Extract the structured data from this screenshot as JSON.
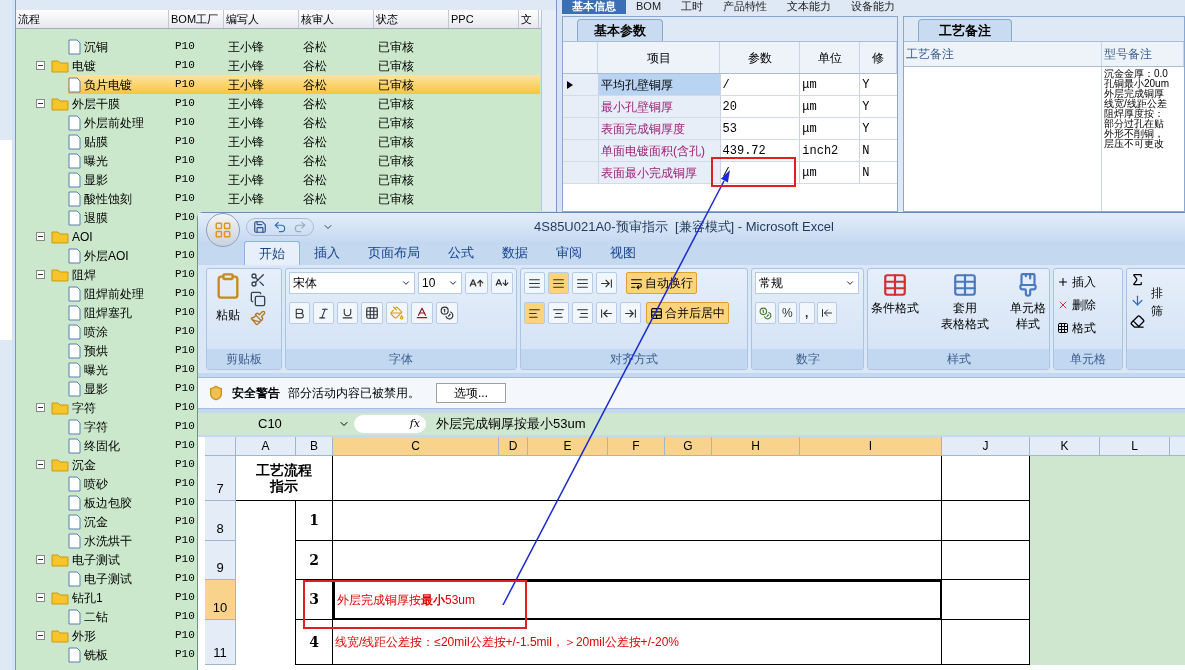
{
  "app_tabs": [
    {
      "label": "基本信息",
      "selected": true
    },
    {
      "label": "BOM",
      "selected": false
    },
    {
      "label": "工时",
      "selected": false
    },
    {
      "label": "产品特性",
      "selected": false
    },
    {
      "label": "文本能力",
      "selected": false
    },
    {
      "label": "设备能力",
      "selected": false
    }
  ],
  "tree": {
    "columns": [
      "流程",
      "BOM工厂",
      "编写人",
      "核审人",
      "状态",
      "PPC",
      "文"
    ],
    "groups": [
      {
        "children": [
          {
            "label": "沉铜",
            "factory": "P10",
            "author": "王小锋",
            "reviewer": "谷松",
            "status": "已审核",
            "selected": false
          }
        ]
      },
      {
        "label": "电镀",
        "factory": "P10",
        "author": "王小锋",
        "reviewer": "谷松",
        "status": "已审核",
        "selected": false,
        "expanded": true,
        "children": [
          {
            "label": "负片电镀",
            "factory": "P10",
            "author": "王小锋",
            "reviewer": "谷松",
            "status": "已审核",
            "selected": true
          }
        ]
      },
      {
        "label": "外层干膜",
        "factory": "P10",
        "author": "王小锋",
        "reviewer": "谷松",
        "status": "已审核",
        "selected": false,
        "expanded": true,
        "children": [
          {
            "label": "外层前处理",
            "factory": "P10",
            "author": "王小锋",
            "reviewer": "谷松",
            "status": "已审核",
            "selected": false
          },
          {
            "label": "贴膜",
            "factory": "P10",
            "author": "王小锋",
            "reviewer": "谷松",
            "status": "已审核",
            "selected": false
          },
          {
            "label": "曝光",
            "factory": "P10",
            "author": "王小锋",
            "reviewer": "谷松",
            "status": "已审核",
            "selected": false
          },
          {
            "label": "显影",
            "factory": "P10",
            "author": "王小锋",
            "reviewer": "谷松",
            "status": "已审核",
            "selected": false
          },
          {
            "label": "酸性蚀刻",
            "factory": "P10",
            "author": "王小锋",
            "reviewer": "谷松",
            "status": "已审核",
            "selected": false
          },
          {
            "label": "退膜",
            "factory": "P10",
            "selected": false
          }
        ]
      },
      {
        "label": "AOI",
        "factory": "P10",
        "selected": false,
        "expanded": true,
        "children": [
          {
            "label": "外层AOI",
            "factory": "P10",
            "selected": false
          }
        ]
      },
      {
        "label": "阻焊",
        "factory": "P10",
        "selected": false,
        "expanded": true,
        "children": [
          {
            "label": "阻焊前处理",
            "factory": "P10",
            "selected": false
          },
          {
            "label": "阻焊塞孔",
            "factory": "P10",
            "selected": false
          },
          {
            "label": "喷涂",
            "factory": "P10",
            "selected": false
          },
          {
            "label": "预烘",
            "factory": "P10",
            "selected": false
          },
          {
            "label": "曝光",
            "factory": "P10",
            "selected": false
          },
          {
            "label": "显影",
            "factory": "P10",
            "selected": false
          }
        ]
      },
      {
        "label": "字符",
        "factory": "P10",
        "selected": false,
        "expanded": true,
        "children": [
          {
            "label": "字符",
            "factory": "P10",
            "selected": false
          },
          {
            "label": "终固化",
            "factory": "P10",
            "selected": false
          }
        ]
      },
      {
        "label": "沉金",
        "factory": "P10",
        "selected": false,
        "expanded": true,
        "children": [
          {
            "label": "喷砂",
            "factory": "P10",
            "selected": false
          },
          {
            "label": "板边包胶",
            "factory": "P10",
            "selected": false
          },
          {
            "label": "沉金",
            "factory": "P10",
            "selected": false
          },
          {
            "label": "水洗烘干",
            "factory": "P10",
            "selected": false
          }
        ]
      },
      {
        "label": "电子测试",
        "factory": "P10",
        "selected": false,
        "expanded": true,
        "children": [
          {
            "label": "电子测试",
            "factory": "P10",
            "selected": false
          }
        ]
      },
      {
        "label": "钻孔1",
        "factory": "P10",
        "selected": false,
        "expanded": true,
        "children": [
          {
            "label": "二钻",
            "factory": "P10",
            "selected": false
          }
        ]
      },
      {
        "label": "外形",
        "factory": "P10",
        "selected": false,
        "expanded": true,
        "children": [
          {
            "label": "铣板",
            "factory": "P10",
            "selected": false
          }
        ]
      }
    ]
  },
  "params": {
    "tab": "基本参数",
    "columns": [
      "项目",
      "参数",
      "单位",
      "修"
    ],
    "rows": [
      {
        "item": "平均孔壁铜厚",
        "value": "/",
        "unit": "μm",
        "modifiable": "Y",
        "selected": true
      },
      {
        "item": "最小孔壁铜厚",
        "value": "20",
        "unit": "μm",
        "modifiable": "Y",
        "selected": false
      },
      {
        "item": "表面完成铜厚度",
        "value": "53",
        "unit": "μm",
        "modifiable": "Y",
        "selected": false
      },
      {
        "item": "单面电镀面积(含孔)",
        "value": "439.72",
        "unit": "inch2",
        "modifiable": "N",
        "selected": false
      },
      {
        "item": "表面最小完成铜厚",
        "value": "/",
        "unit": "μm",
        "modifiable": "N",
        "selected": false
      }
    ]
  },
  "notes": {
    "tab": "工艺备注",
    "columns": [
      "工艺备注",
      "型号备注"
    ],
    "model_notes": [
      "沉金金厚：0.0",
      "孔铜最小20um",
      "外层完成铜厚",
      "线宽/线距公差",
      "阻焊厚度按：",
      "部分过孔在贴",
      "外形不削铜，",
      "层压不可更改"
    ]
  },
  "excel": {
    "title": "4S85U021A0-预审指示  [兼容模式] - Microsoft Excel",
    "tabs": [
      {
        "label": "开始",
        "selected": true
      },
      {
        "label": "插入",
        "selected": false
      },
      {
        "label": "页面布局",
        "selected": false
      },
      {
        "label": "公式",
        "selected": false
      },
      {
        "label": "数据",
        "selected": false
      },
      {
        "label": "审阅",
        "selected": false
      },
      {
        "label": "视图",
        "selected": false
      }
    ],
    "ribbon": {
      "clipboard": {
        "label": "剪贴板",
        "paste": "粘贴"
      },
      "font": {
        "label": "字体",
        "name": "宋体",
        "size": "10"
      },
      "alignment": {
        "label": "对齐方式",
        "wrap": "自动换行",
        "merge": "合并后居中"
      },
      "number": {
        "label": "数字",
        "format": "常规",
        "percent": "%",
        "comma": ","
      },
      "styles": {
        "label": "样式",
        "buttons": [
          {
            "lines": [
              "条件格式"
            ]
          },
          {
            "lines": [
              "套用",
              "表格格式"
            ]
          },
          {
            "lines": [
              "单元格",
              "样式"
            ]
          }
        ]
      },
      "cells": {
        "label": "单元格",
        "buttons": [
          "插入",
          "删除",
          "格式"
        ]
      },
      "editing": {
        "sort": "排",
        "filter": "筛"
      }
    },
    "security": {
      "title": "安全警告",
      "message": "部分活动内容已被禁用。",
      "button": "选项..."
    },
    "formula": {
      "cell": "C10",
      "fx": "fx",
      "content": "外层完成铜厚按最小53um"
    },
    "columns": [
      {
        "label": "A",
        "selected": false
      },
      {
        "label": "B",
        "selected": false
      },
      {
        "label": "C",
        "selected": true
      },
      {
        "label": "D",
        "selected": true
      },
      {
        "label": "E",
        "selected": true
      },
      {
        "label": "F",
        "selected": true
      },
      {
        "label": "G",
        "selected": true
      },
      {
        "label": "H",
        "selected": true
      },
      {
        "label": "I",
        "selected": true
      },
      {
        "label": "J",
        "selected": false
      },
      {
        "label": "K",
        "selected": false
      },
      {
        "label": "L",
        "selected": false
      }
    ],
    "rows": [
      {
        "number": "7",
        "selected": false,
        "heading": [
          "工艺流程",
          "指示"
        ]
      },
      {
        "number": "8",
        "selected": false,
        "step": "1"
      },
      {
        "number": "9",
        "selected": false,
        "step": "2"
      },
      {
        "number": "10",
        "selected": true,
        "step": "3",
        "text": "外层完成铜厚按**最小**53um"
      },
      {
        "number": "11",
        "selected": false,
        "step": "4",
        "text": "线宽/线距公差按：≤20mil公差按+/-1.5mil，＞20mil公差按+/-20%"
      }
    ]
  }
}
